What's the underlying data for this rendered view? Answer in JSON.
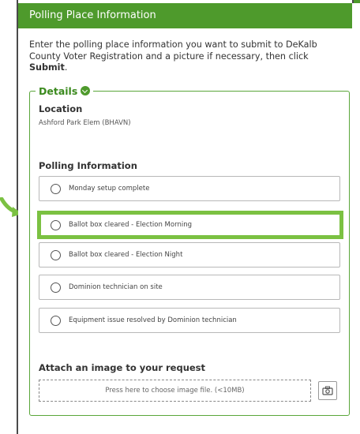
{
  "header": {
    "title": "Polling Place Information"
  },
  "intro": {
    "text": "Enter the polling place information you want to submit to DeKalb County Voter Registration and a picture if necessary, then click ",
    "emphasis": "Submit",
    "end": "."
  },
  "details": {
    "legend": "Details",
    "location_label": "Location",
    "location_value": "Ashford Park Elem (BHAVN)",
    "polling_label": "Polling Information",
    "options": [
      "Monday setup complete",
      "Ballot box cleared - Election Morning",
      "Ballot box cleared - Election Night",
      "Dominion technician on site",
      "Equipment issue resolved by Dominion technician"
    ],
    "highlighted_option_index": 1
  },
  "attach": {
    "label": "Attach an image to your request",
    "dropzone_text": "Press here to choose image file. (<10MB)"
  },
  "colors": {
    "brand_green": "#4e9a2c",
    "highlight_green": "#7bc142"
  },
  "icons": {
    "legend_toggle": "chevron-down-icon",
    "camera": "camera-icon",
    "annotation_arrow": "arrow-icon"
  }
}
